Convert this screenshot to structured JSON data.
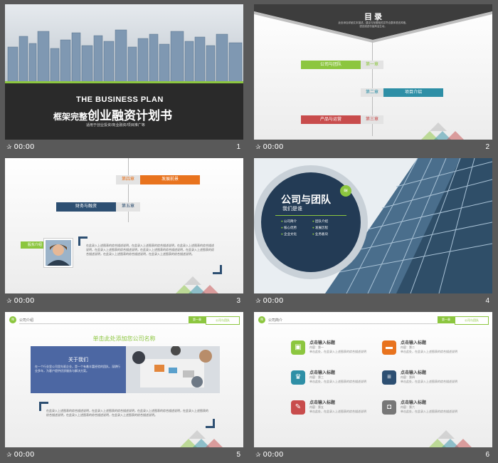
{
  "slides": [
    {
      "num": "1",
      "time": "00:00",
      "title_en": "THE BUSINESS PLAN",
      "title_zh_small": "框架完整",
      "title_zh_large": "创业融资计划书",
      "subtitle": "适用于创业投资/商业融资/项目推广等"
    },
    {
      "num": "2",
      "time": "00:00",
      "title": "目  录",
      "desc_line1": "此处添加详细文本描述，建议与标题相关并符合整体语言风格，",
      "desc_line2": "语言描述尽量简洁生动。",
      "items": [
        {
          "label": "公司与团队",
          "chapter": "第一章"
        },
        {
          "label": "项目介绍",
          "chapter": "第二章"
        },
        {
          "label": "产品与运营",
          "chapter": "第三章"
        }
      ]
    },
    {
      "num": "3",
      "time": "00:00",
      "items": [
        {
          "chapter": "第四章",
          "label": "发展前景"
        },
        {
          "chapter": "第五章",
          "label": "财务与融资"
        }
      ],
      "person_tag": "股东介绍",
      "para": "在此录入上述图表的综合描述说明，在此录入上述图表的综合描述说明，在此录入上述图表的综合描述说明，在此录入上述图表的综合描述说明，在此录入上述图表的综合描述说明，在此录入上述图表的综合描述说明，在此录入上述图表的综合描述说明，在此录入上述图表的综合描述说明。"
    },
    {
      "num": "4",
      "time": "00:00",
      "circle_title": "公司与团队",
      "circle_sub": "我们是谁",
      "bullets": [
        "公司简介",
        "团队介绍",
        "核心优势",
        "发展历程",
        "企业文化",
        "业务板块"
      ]
    },
    {
      "num": "5",
      "time": "00:00",
      "header": "公司介绍",
      "tabs": [
        "第一章",
        "公司与团队"
      ],
      "headline": "单击此处添加您公司名称",
      "box_title": "关于我们",
      "box_text": "在一个行业里公司里先驱企业，是一个有着丰富经验的团队，深耕行业多年，为客户提供优质服务与解决方案。",
      "para": "在此录入上述图表的综合描述说明，在此录入上述图表的综合描述说明，在此录入上述图表的综合描述说明，在此录入上述图表的综合描述说明，在此录入上述图表的综合描述说明，在此录入上述图表的综合描述说明。"
    },
    {
      "num": "6",
      "time": "00:00",
      "header": "公司简介",
      "tabs": [
        "第一章",
        "公司与团队"
      ],
      "cards": [
        {
          "icon": "presentation-icon",
          "color": "#8cc63f",
          "title": "点击输入标题",
          "sub": "内容：第一",
          "text": "单击此处，在此录入上述图表的综合描述说明"
        },
        {
          "icon": "chat-icon",
          "color": "#e8731e",
          "title": "点击输入标题",
          "sub": "内容：第二",
          "text": "单击此处，在此录入上述图表的综合描述说明"
        },
        {
          "icon": "trophy-icon",
          "color": "#2e8fa6",
          "title": "点击输入标题",
          "sub": "内容：第三",
          "text": "单击此处，在此录入上述图表的综合描述说明"
        },
        {
          "icon": "database-icon",
          "color": "#2d4f72",
          "title": "点击输入标题",
          "sub": "内容：第四",
          "text": "单击此处，在此录入上述图表的综合描述说明"
        },
        {
          "icon": "pencil-icon",
          "color": "#c84c4c",
          "title": "点击输入标题",
          "sub": "内容：第五",
          "text": "单击此处，在此录入上述图表的综合描述说明"
        },
        {
          "icon": "camera-icon",
          "color": "#777777",
          "title": "点击输入标题",
          "sub": "内容：第六",
          "text": "单击此处，在此录入上述图表的综合描述说明"
        }
      ]
    }
  ]
}
